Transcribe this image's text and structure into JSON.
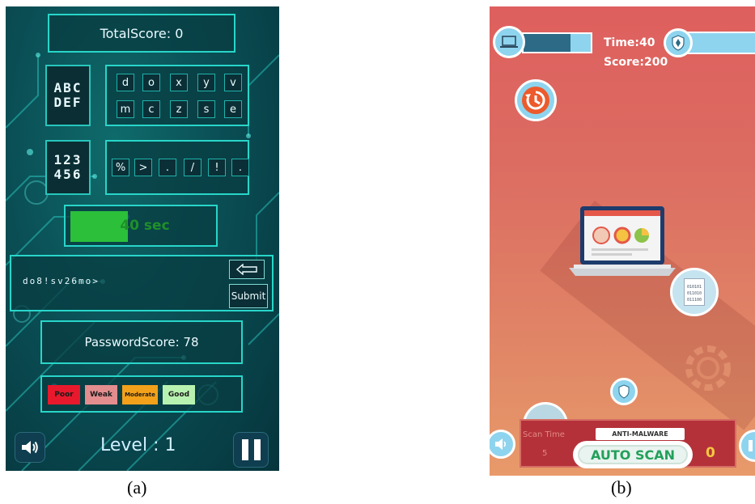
{
  "panel_a": {
    "total_score": "TotalScore: 0",
    "letter_tile": "ABC\nDEF",
    "number_tile": "123\n456",
    "letter_keys": [
      "d",
      "o",
      "x",
      "y",
      "v",
      "m",
      "c",
      "z",
      "s",
      "e"
    ],
    "symbol_keys": [
      "%",
      ">",
      ".",
      "/",
      "!",
      "."
    ],
    "timer_text": "40 sec",
    "timer_fraction": 0.4,
    "password_value": "do8!sv26mo>",
    "submit_label": "Submit",
    "password_score": "PasswordScore: 78",
    "strength_levels": [
      {
        "label": "Poor",
        "color": "#e8192c"
      },
      {
        "label": "Weak",
        "color": "#e38d8f"
      },
      {
        "label": "Moderate",
        "color": "#f3a11a"
      },
      {
        "label": "Good",
        "color": "#b8f2b0"
      }
    ],
    "level_text": "Level : 1",
    "colors": {
      "accent": "#28d6c9",
      "timer": "#2bbf3a"
    },
    "icons": {
      "sound": "speaker-icon",
      "pause": "pause-icon",
      "backspace": "backspace-arrow-icon"
    }
  },
  "panel_b": {
    "time_label": "Time:40",
    "score_label": "Score:200",
    "health_fraction": 0.7,
    "anti_malware_label": "ANTI-MALWARE",
    "auto_scan_label": "AUTO SCAN",
    "scan_time_label": "Scan Time",
    "scan_time_value": "5",
    "scan_count": "0",
    "file_binary": [
      "010101",
      "011010",
      "011100"
    ],
    "colors": {
      "bar": "#8fd4ee",
      "bar_fill": "#2c6a86",
      "scan_text": "#23a05b",
      "panel": "#b5313a"
    },
    "icons": {
      "laptop": "laptop-icon",
      "shield": "shield-icon",
      "history": "history-icon",
      "file": "binary-file-icon",
      "gear": "gear-icon"
    }
  },
  "captions": {
    "a": "(a)",
    "b": "(b)"
  }
}
